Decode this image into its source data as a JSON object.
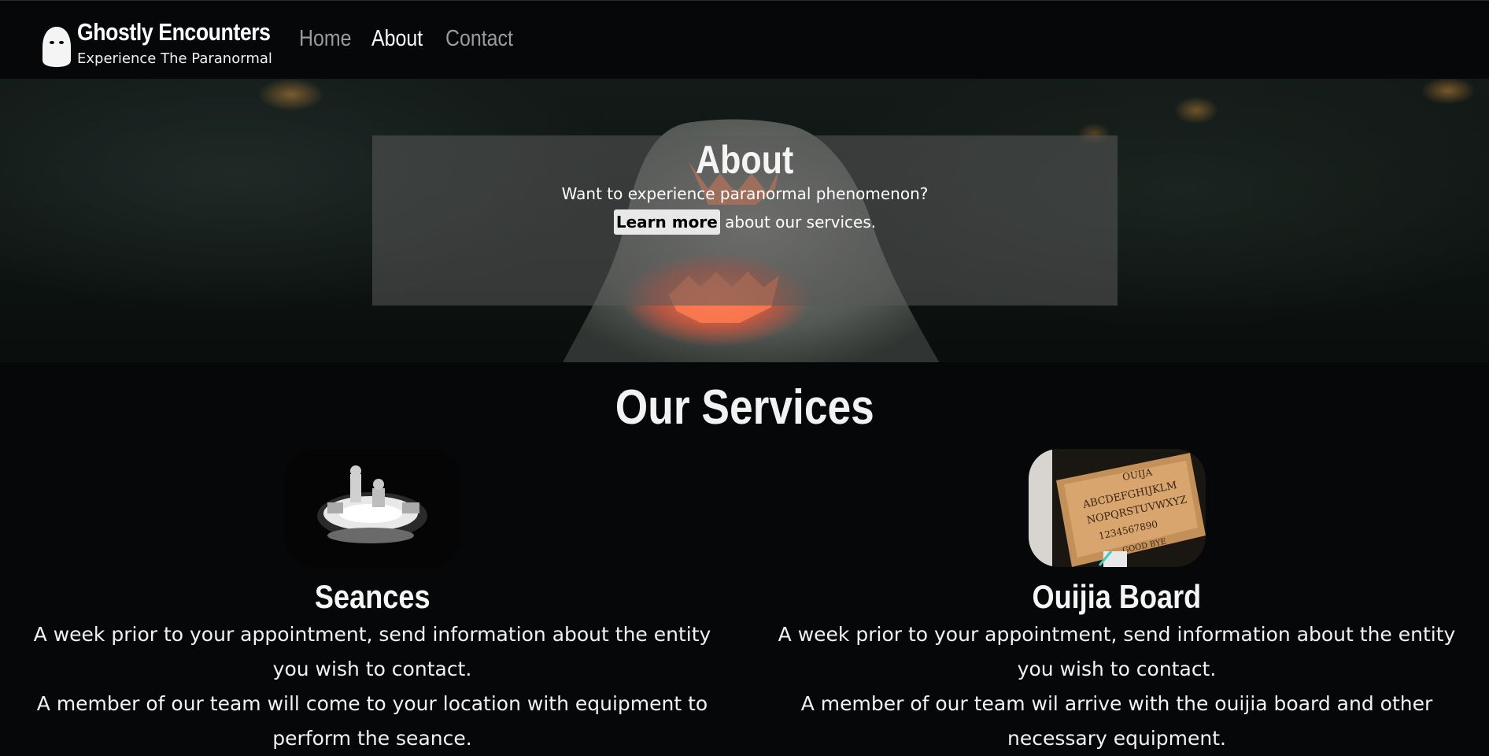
{
  "header": {
    "brand_title": "Ghostly Encounters",
    "brand_subtitle": "Experience The Paranormal",
    "logo_icon": "ghost-icon",
    "nav": [
      {
        "label": "Home",
        "active": false
      },
      {
        "label": "About",
        "active": true
      },
      {
        "label": "Contact",
        "active": false
      }
    ]
  },
  "hero": {
    "title": "About",
    "line1": "Want to experience paranormal phenomenon?",
    "learn_more_label": "Learn more",
    "line2_suffix": " about our services."
  },
  "services": {
    "title": "Our Services",
    "items": [
      {
        "name": "Seances",
        "image": "seance-photo",
        "desc_line1": "A week prior to your appointment, send information about the entity you wish to contact.",
        "desc_line2": "A member of our team will come to your location with equipment to perform the seance."
      },
      {
        "name": "Ouijia Board",
        "image": "ouija-board-photo",
        "desc_line1": "A week prior to your appointment, send information about the entity you wish to contact.",
        "desc_line2": "A member of our team wil arrive with the ouijia board and other necessary equipment."
      }
    ]
  },
  "colors": {
    "background": "#050708",
    "nav_inactive": "#9b9b9b",
    "nav_active": "#ffffff",
    "overlay": "rgba(90,90,90,0.55)"
  }
}
